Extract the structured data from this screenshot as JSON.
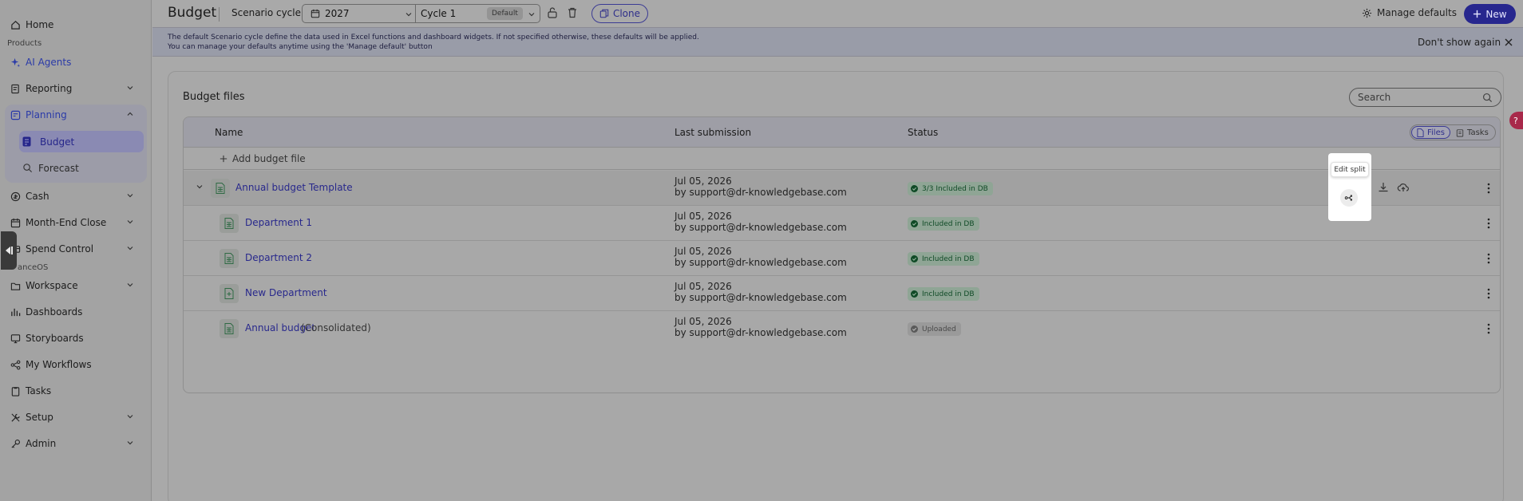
{
  "sidebar": {
    "home": "Home",
    "products_section": "Products",
    "ai_agents": "AI Agents",
    "reporting": "Reporting",
    "planning": "Planning",
    "budget": "Budget",
    "forecast": "Forecast",
    "cash": "Cash",
    "month_end_close": "Month-End Close",
    "spend_control": "Spend Control",
    "financeos_section": "anceOS",
    "workspace": "Workspace",
    "dashboards": "Dashboards",
    "storyboards": "Storyboards",
    "my_workflows": "My Workflows",
    "tasks": "Tasks",
    "setup": "Setup",
    "admin": "Admin"
  },
  "topbar": {
    "title": "Budget",
    "scenario_label": "Scenario cycle:",
    "year": "2027",
    "cycle": "Cycle 1",
    "default_badge": "Default",
    "clone": "Clone",
    "manage_defaults": "Manage defaults",
    "new": "New"
  },
  "banner": {
    "line1": "The default Scenario cycle define the data used in Excel functions and dashboard widgets. If not specified otherwise, these defaults will be applied.",
    "line2": "You can manage your defaults anytime using the 'Manage default' button",
    "dont_show": "Don't show again"
  },
  "card": {
    "title": "Budget files",
    "search_placeholder": "Search",
    "columns": {
      "name": "Name",
      "last_submission": "Last submission",
      "status": "Status"
    },
    "view_files": "Files",
    "view_tasks": "Tasks",
    "add_file": "Add budget file",
    "tooltip": "Edit split",
    "rows": [
      {
        "name": "Annual budget Template",
        "suffix": "",
        "date": "Jul 05, 2026",
        "by": "by support@dr-knowledgebase.com",
        "status": "3/3 Included in DB"
      },
      {
        "name": "Department 1",
        "suffix": "",
        "date": "Jul 05, 2026",
        "by": "by support@dr-knowledgebase.com",
        "status": "Included in DB"
      },
      {
        "name": "Department 2",
        "suffix": "",
        "date": "Jul 05, 2026",
        "by": "by support@dr-knowledgebase.com",
        "status": "Included in DB"
      },
      {
        "name": "New Department",
        "suffix": "",
        "date": "Jul 05, 2026",
        "by": "by support@dr-knowledgebase.com",
        "status": "Included in DB"
      },
      {
        "name": "Annual budget",
        "suffix": "(Consolidated)",
        "date": "Jul 05, 2026",
        "by": "by support@dr-knowledgebase.com",
        "status": "Uploaded"
      }
    ]
  },
  "colors": {
    "brand": "#27278e",
    "accent_link": "#28288c",
    "status_ok": "#0f4a26",
    "help": "#a8294a"
  }
}
